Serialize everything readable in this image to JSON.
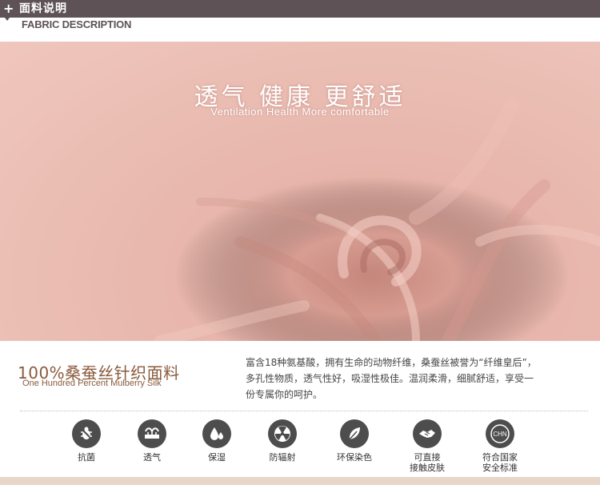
{
  "header": {
    "plus": "+",
    "title": "面料说明",
    "subtitle": "FABRIC DESCRIPTION"
  },
  "hero": {
    "slogan_cn": "透气  健康  更舒适",
    "slogan_en": "Ventilation  Health  More comfortable"
  },
  "info": {
    "title_cn": "100%桑蚕丝针织面料",
    "title_en": "One Hundred Percent Mulberry Silk",
    "description": [
      "富含18种氨基酸，拥有生命的动物纤维，桑蚕丝被誉为“纤维皇后”，",
      "多孔性物质，透气性好，吸湿性极佳。温润柔滑，细腻舒适，享受一",
      "份专属你的呵护。"
    ]
  },
  "features": [
    {
      "label": "抗菌",
      "icon": "antibacterial-icon"
    },
    {
      "label": "透气",
      "icon": "breathable-icon"
    },
    {
      "label": "保湿",
      "icon": "moisturizing-icon"
    },
    {
      "label": "防辐射",
      "icon": "anti-radiation-icon"
    },
    {
      "label": "环保染色",
      "icon": "eco-dye-icon"
    },
    {
      "label": "可直接\n接触皮肤",
      "icon": "skin-contact-icon"
    },
    {
      "label": "符合国家\n安全标准",
      "icon": "national-standard-icon"
    }
  ],
  "badge_text": "CHN",
  "colors": {
    "header_bg": "#5e5257",
    "fabric_pink": "#e9bbb1",
    "silk_brown": "#8a5a3c",
    "icon_gray": "#4d4d4d",
    "bottom_bar": "#e7d6c9"
  }
}
